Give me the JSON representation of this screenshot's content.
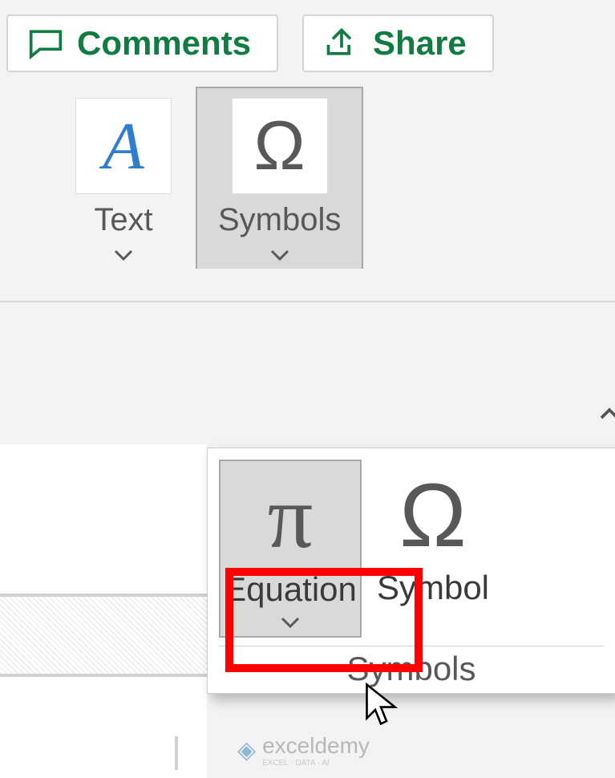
{
  "topbar": {
    "comments_label": "Comments",
    "share_label": "Share"
  },
  "ribbon": {
    "text_group_label": "Text",
    "symbols_group_label": "Symbols"
  },
  "dropdown": {
    "equation_label": "Equation",
    "symbol_label": "Symbol",
    "footer_label": "Symbols"
  },
  "watermark": {
    "brand": "exceldemy",
    "tagline": "EXCEL · DATA · AI"
  }
}
